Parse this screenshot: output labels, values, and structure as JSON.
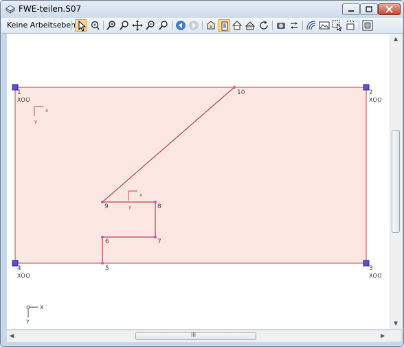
{
  "window": {
    "title": "FWE-teilen.S07",
    "buttons": [
      "minimize-icon",
      "maximize-icon",
      "close-icon"
    ]
  },
  "toolbar": {
    "dropdown_label": "Keine Arbeitseben",
    "icons": [
      "pointer-icon",
      "rotate-view-icon",
      "zoom-in-icon",
      "zoom-window-icon",
      "pan-icon",
      "zoom-all-icon",
      "zoom-previous-icon",
      "back-icon",
      "forward-icon",
      "view-3d-icon",
      "view-2d-icon",
      "house-icon",
      "roof-icon",
      "refresh-icon",
      "render-icon",
      "swap-icon",
      "plan-icon",
      "image-icon",
      "select-region-icon",
      "info-icon",
      "settings-icon"
    ]
  },
  "drawing": {
    "colors": {
      "fill": "#fde7e3",
      "line": "#b5434d",
      "node": "#c455c4",
      "corner": "#5b4fd6",
      "text": "#333333",
      "axis": "#b5434d"
    },
    "corner_tags": [
      "XOO",
      "XOO",
      "XOO",
      "XOO"
    ],
    "node_labels": [
      "1",
      "2",
      "3",
      "4",
      "5",
      "6",
      "7",
      "8",
      "9",
      "10"
    ],
    "axis_x": "x",
    "axis_y": "y",
    "global_axis_x": "X",
    "global_axis_y": "Y"
  },
  "scrollbars": {
    "horizontal_grip": "III"
  }
}
